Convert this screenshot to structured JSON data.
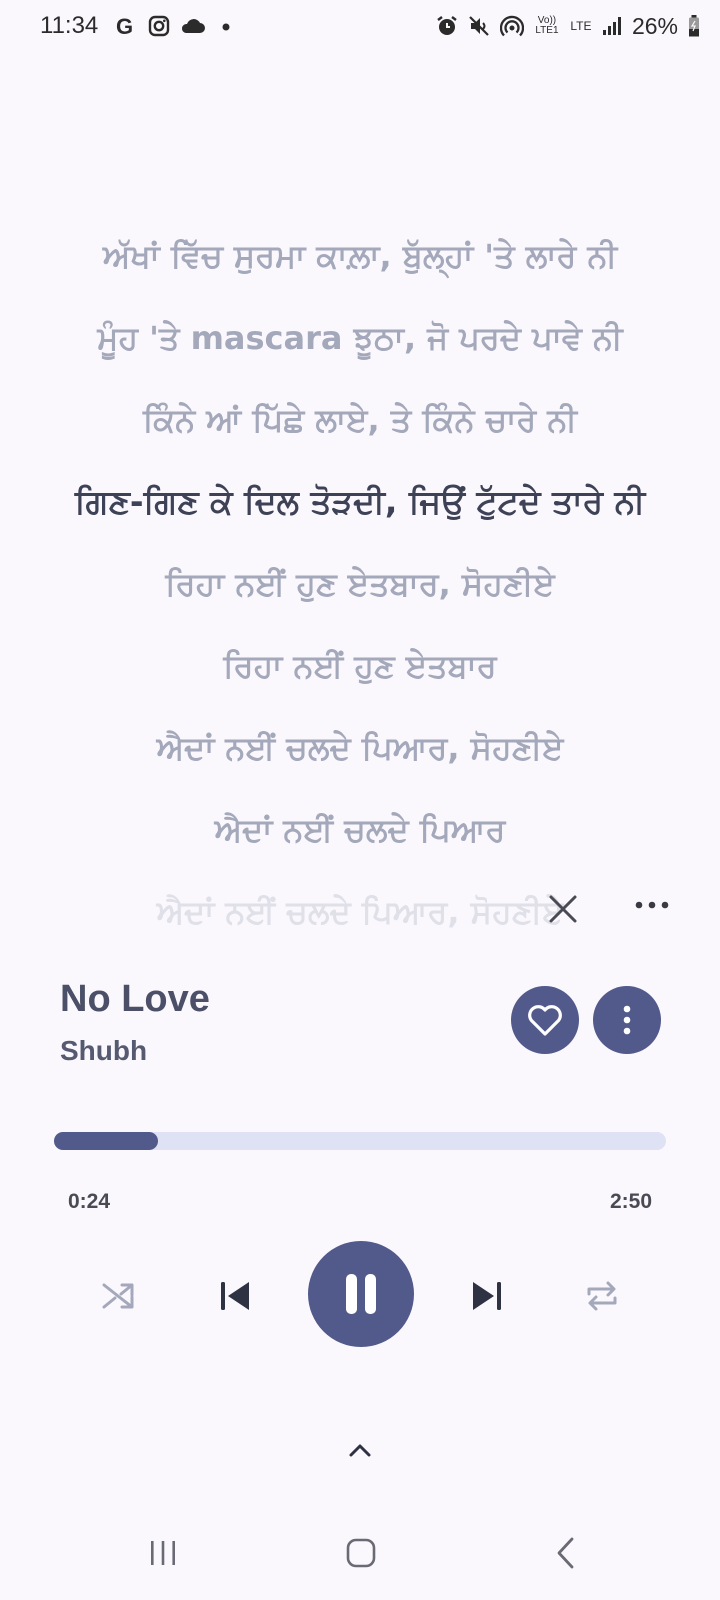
{
  "status_bar": {
    "time": "11:34",
    "left_icons": [
      "google-icon",
      "instagram-icon",
      "cloud-icon",
      "dot-icon"
    ],
    "right_icons": [
      "alarm-icon",
      "mute-icon",
      "hotspot-icon",
      "volte-icon",
      "lte-icon",
      "signal-icon",
      "battery-icon"
    ],
    "volte_label": "Vo)) LTE1",
    "lte_label": "LTE",
    "battery": "26%"
  },
  "lyrics": {
    "lines": [
      "ਅੱਖਾਂ ਵਿੱਚ ਸੁਰਮਾ ਕਾਲ਼ਾ, ਬੁੱਲ੍ਹਾਂ 'ਤੇ ਲਾਰੇ ਨੀ",
      "ਮੂੰਹ 'ਤੇ mascara ਝੂਠਾ, ਜੋ ਪਰਦੇ ਪਾਵੇ ਨੀ",
      "ਕਿੰਨੇ ਆਂ ਪਿੱਛੇ ਲਾਏ, ਤੇ ਕਿੰਨੇ ਚਾਰੇ ਨੀ",
      "ਗਿਣ-ਗਿਣ ਕੇ ਦਿਲ ਤੋੜਦੀ, ਜਿਉਂ ਟੁੱਟਦੇ ਤਾਰੇ ਨੀ",
      "ਰਿਹਾ ਨਈਂ ਹੁਣ ਏਤਬਾਰ, ਸੋਹਣੀਏ",
      "ਰਿਹਾ ਨਈਂ ਹੁਣ ਏਤਬਾਰ",
      "ਐਦਾਂ ਨਈਂ ਚਲਦੇ ਪਿਆਰ, ਸੋਹਣੀਏ",
      "ਐਦਾਂ ਨਈਂ ਚਲਦੇ ਪਿਆਰ",
      "ਐਦਾਂ ਨਈਂ ਚਲਦੇ ਪਿਆਰ, ਸੋਹਣੀਏ"
    ],
    "active_index": 3
  },
  "track": {
    "title": "No Love",
    "artist": "Shubh"
  },
  "progress": {
    "current": "0:24",
    "total": "2:50",
    "fraction": 0.17
  },
  "controls": [
    "shuffle-icon",
    "previous-icon",
    "pause-icon",
    "next-icon",
    "repeat-icon"
  ],
  "colors": {
    "accent": "#525a8c",
    "progress_bg": "#dfe1f4",
    "background": "#fbf8fd",
    "lyric_inactive": "#a4a8bb",
    "lyric_active": "#3e4257"
  }
}
